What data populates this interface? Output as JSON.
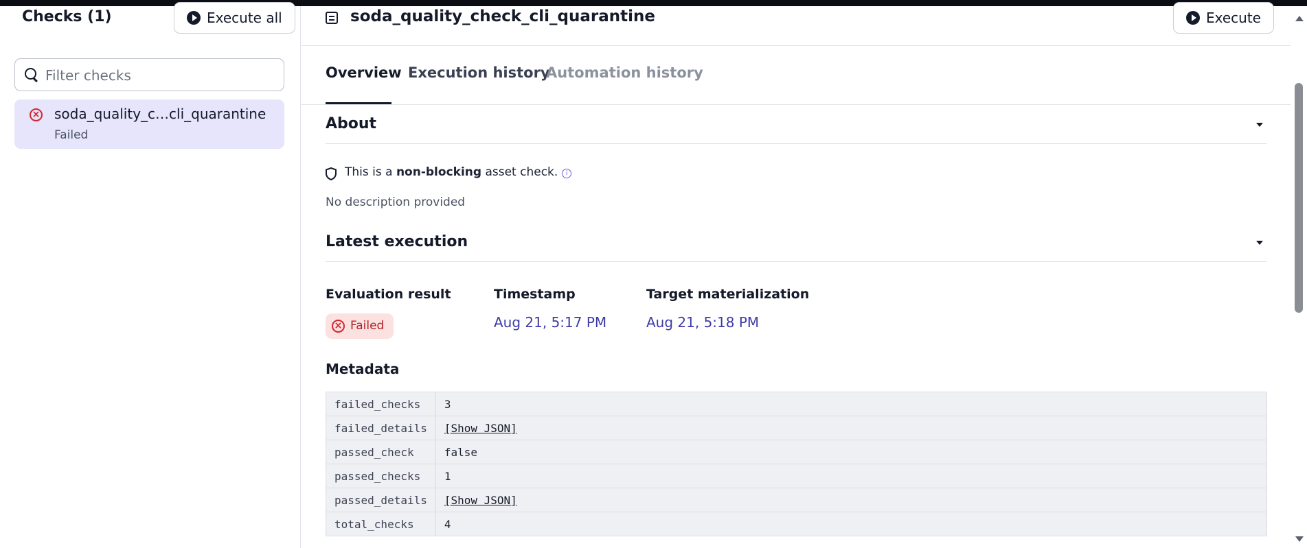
{
  "sidebar": {
    "title": "Checks (1)",
    "execute_all_label": "Execute all",
    "filter_placeholder": "Filter checks",
    "items": [
      {
        "name": "soda_quality_c…cli_quarantine",
        "status": "Failed"
      }
    ]
  },
  "header": {
    "title": "soda_quality_check_cli_quarantine",
    "execute_label": "Execute"
  },
  "tabs": [
    {
      "label": "Overview",
      "active": true
    },
    {
      "label": "Execution history",
      "active": false
    },
    {
      "label": "Automation history",
      "active": false,
      "disabled": true
    }
  ],
  "about": {
    "heading": "About",
    "nonblocking_prefix": "This is a ",
    "nonblocking_bold": "non-blocking",
    "nonblocking_suffix": " asset check.",
    "description": "No description provided"
  },
  "latest_execution": {
    "heading": "Latest execution",
    "evaluation_label": "Evaluation result",
    "evaluation_value": "Failed",
    "timestamp_label": "Timestamp",
    "timestamp_value": "Aug 21, 5:17 PM",
    "target_label": "Target materialization",
    "target_value": "Aug 21, 5:18 PM"
  },
  "metadata": {
    "heading": "Metadata",
    "rows": [
      {
        "key": "failed_checks",
        "value": "3",
        "link": false
      },
      {
        "key": "failed_details",
        "value": "[Show JSON]",
        "link": true
      },
      {
        "key": "passed_check",
        "value": "false",
        "link": false
      },
      {
        "key": "passed_checks",
        "value": "1",
        "link": false
      },
      {
        "key": "passed_details",
        "value": "[Show JSON]",
        "link": true
      },
      {
        "key": "total_checks",
        "value": "4",
        "link": false
      }
    ]
  },
  "colors": {
    "failed_red": "#d3262e",
    "badge_bg": "#fbe1e0",
    "selected_item_bg": "#e6e5fb",
    "link_blue": "#3d3aa8"
  }
}
